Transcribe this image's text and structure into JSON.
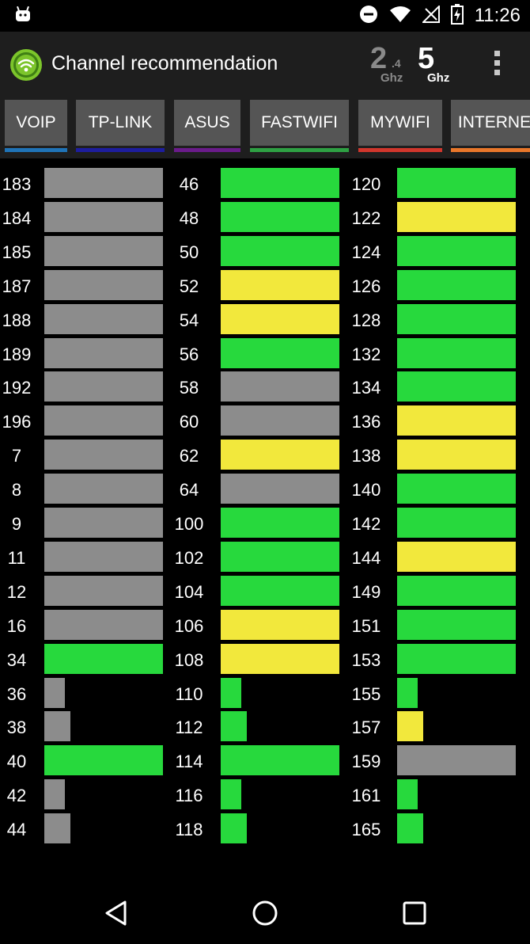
{
  "status_bar": {
    "time": "11:26",
    "icons": [
      "android-icon",
      "do-not-disturb-icon",
      "wifi-icon",
      "no-signal-icon",
      "battery-charging-icon"
    ]
  },
  "app_bar": {
    "title": "Channel recommendation",
    "band_24": {
      "number": "2",
      "sub": ".4",
      "unit": "Ghz",
      "selected": false
    },
    "band_5": {
      "number": "5",
      "unit": "Ghz",
      "selected": true
    },
    "icons": [
      "wifi-logo-icon",
      "overflow-menu-icon"
    ]
  },
  "colors": {
    "green": "#27d93d",
    "yellow": "#f2e83c",
    "gray": "#8c8c8c",
    "tab_bg": "#555555",
    "toolbar_bg": "#1e1e1e"
  },
  "tabs": [
    {
      "label": "VOIP",
      "color": "#1f73b7"
    },
    {
      "label": "TP-LINK",
      "color": "#1d1d9e"
    },
    {
      "label": "ASUS",
      "color": "#6a1b8a"
    },
    {
      "label": "FASTWIFI",
      "color": "#2ea043"
    },
    {
      "label": "MYWIFI",
      "color": "#d0362c"
    },
    {
      "label": "INTERNE",
      "color": "#e8772a"
    }
  ],
  "channel_columns": [
    [
      {
        "ch": "183",
        "level": 1.0,
        "status": "gray"
      },
      {
        "ch": "184",
        "level": 1.0,
        "status": "gray"
      },
      {
        "ch": "185",
        "level": 1.0,
        "status": "gray"
      },
      {
        "ch": "187",
        "level": 1.0,
        "status": "gray"
      },
      {
        "ch": "188",
        "level": 1.0,
        "status": "gray"
      },
      {
        "ch": "189",
        "level": 1.0,
        "status": "gray"
      },
      {
        "ch": "192",
        "level": 1.0,
        "status": "gray"
      },
      {
        "ch": "196",
        "level": 1.0,
        "status": "gray"
      },
      {
        "ch": "7",
        "level": 1.0,
        "status": "gray"
      },
      {
        "ch": "8",
        "level": 1.0,
        "status": "gray"
      },
      {
        "ch": "9",
        "level": 1.0,
        "status": "gray"
      },
      {
        "ch": "11",
        "level": 1.0,
        "status": "gray"
      },
      {
        "ch": "12",
        "level": 1.0,
        "status": "gray"
      },
      {
        "ch": "16",
        "level": 1.0,
        "status": "gray"
      },
      {
        "ch": "34",
        "level": 1.0,
        "status": "green"
      },
      {
        "ch": "36",
        "level": 0.17,
        "status": "gray"
      },
      {
        "ch": "38",
        "level": 0.22,
        "status": "gray"
      },
      {
        "ch": "40",
        "level": 1.0,
        "status": "green"
      },
      {
        "ch": "42",
        "level": 0.17,
        "status": "gray"
      },
      {
        "ch": "44",
        "level": 0.22,
        "status": "gray"
      }
    ],
    [
      {
        "ch": "46",
        "level": 1.0,
        "status": "green"
      },
      {
        "ch": "48",
        "level": 1.0,
        "status": "green"
      },
      {
        "ch": "50",
        "level": 1.0,
        "status": "green"
      },
      {
        "ch": "52",
        "level": 1.0,
        "status": "yellow"
      },
      {
        "ch": "54",
        "level": 1.0,
        "status": "yellow"
      },
      {
        "ch": "56",
        "level": 1.0,
        "status": "green"
      },
      {
        "ch": "58",
        "level": 1.0,
        "status": "gray"
      },
      {
        "ch": "60",
        "level": 1.0,
        "status": "gray"
      },
      {
        "ch": "62",
        "level": 1.0,
        "status": "yellow"
      },
      {
        "ch": "64",
        "level": 1.0,
        "status": "gray"
      },
      {
        "ch": "100",
        "level": 1.0,
        "status": "green"
      },
      {
        "ch": "102",
        "level": 1.0,
        "status": "green"
      },
      {
        "ch": "104",
        "level": 1.0,
        "status": "green"
      },
      {
        "ch": "106",
        "level": 1.0,
        "status": "yellow"
      },
      {
        "ch": "108",
        "level": 1.0,
        "status": "yellow"
      },
      {
        "ch": "110",
        "level": 0.17,
        "status": "green"
      },
      {
        "ch": "112",
        "level": 0.22,
        "status": "green"
      },
      {
        "ch": "114",
        "level": 1.0,
        "status": "green"
      },
      {
        "ch": "116",
        "level": 0.17,
        "status": "green"
      },
      {
        "ch": "118",
        "level": 0.22,
        "status": "green"
      }
    ],
    [
      {
        "ch": "120",
        "level": 1.0,
        "status": "green"
      },
      {
        "ch": "122",
        "level": 1.0,
        "status": "yellow"
      },
      {
        "ch": "124",
        "level": 1.0,
        "status": "green"
      },
      {
        "ch": "126",
        "level": 1.0,
        "status": "green"
      },
      {
        "ch": "128",
        "level": 1.0,
        "status": "green"
      },
      {
        "ch": "132",
        "level": 1.0,
        "status": "green"
      },
      {
        "ch": "134",
        "level": 1.0,
        "status": "green"
      },
      {
        "ch": "136",
        "level": 1.0,
        "status": "yellow"
      },
      {
        "ch": "138",
        "level": 1.0,
        "status": "yellow"
      },
      {
        "ch": "140",
        "level": 1.0,
        "status": "green"
      },
      {
        "ch": "142",
        "level": 1.0,
        "status": "green"
      },
      {
        "ch": "144",
        "level": 1.0,
        "status": "yellow"
      },
      {
        "ch": "149",
        "level": 1.0,
        "status": "green"
      },
      {
        "ch": "151",
        "level": 1.0,
        "status": "green"
      },
      {
        "ch": "153",
        "level": 1.0,
        "status": "green"
      },
      {
        "ch": "155",
        "level": 0.17,
        "status": "green"
      },
      {
        "ch": "157",
        "level": 0.22,
        "status": "yellow"
      },
      {
        "ch": "159",
        "level": 1.0,
        "status": "gray"
      },
      {
        "ch": "161",
        "level": 0.17,
        "status": "green"
      },
      {
        "ch": "165",
        "level": 0.22,
        "status": "green"
      }
    ]
  ],
  "nav_bar": {
    "icons": [
      "back-icon",
      "home-icon",
      "recents-icon"
    ]
  }
}
